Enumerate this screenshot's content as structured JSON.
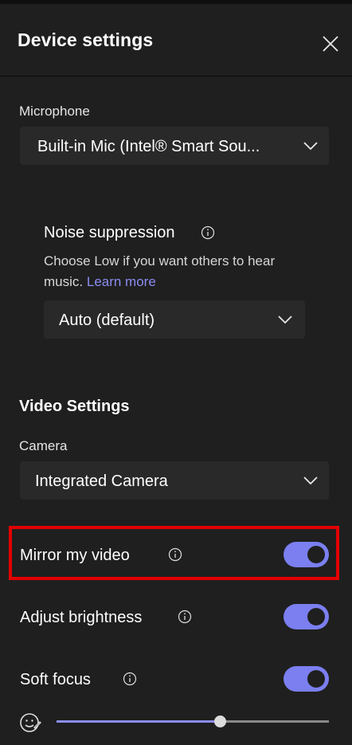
{
  "header": {
    "title": "Device settings"
  },
  "microphone": {
    "label": "Microphone",
    "selected": "Built-in Mic (Intel® Smart Sou..."
  },
  "noise_suppression": {
    "title": "Noise suppression",
    "description": "Choose Low if you want others to hear music.",
    "link": "Learn more",
    "selected": "Auto (default)"
  },
  "video_settings": {
    "title": "Video Settings",
    "camera_label": "Camera",
    "camera_selected": "Integrated Camera",
    "toggles": [
      {
        "label": "Mirror my video",
        "on": true
      },
      {
        "label": "Adjust brightness",
        "on": true
      },
      {
        "label": "Soft focus",
        "on": true
      }
    ],
    "soft_focus_level": 0.6
  },
  "colors": {
    "accent": "#7b7ff0",
    "link": "#8b8cf0",
    "highlight": "#e30000",
    "background": "#1f1f1f",
    "select_background": "#292929"
  },
  "icons": [
    "close-icon",
    "chevron-down-icon",
    "info-icon",
    "face-retouch-icon"
  ]
}
